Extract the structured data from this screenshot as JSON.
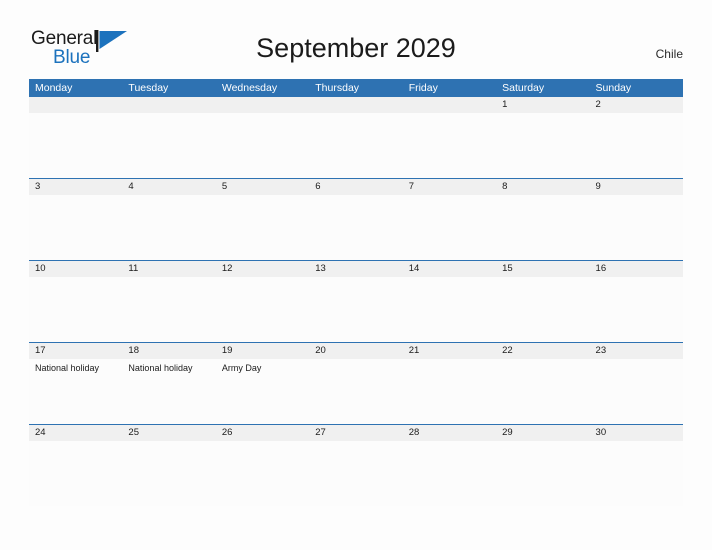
{
  "brand": {
    "name_part1": "General",
    "name_part2": "Blue",
    "flag_icon": "blue-triangle-flag-icon",
    "accent_color": "#1c72bd"
  },
  "header": {
    "title": "September 2029",
    "country": "Chile"
  },
  "theme": {
    "header_blue": "#2e72b2",
    "date_strip_gray": "#f0f0f0",
    "cell_white": "#fcfcfc",
    "page_background": "#fdfdfd",
    "text_dark": "#1b1b1b"
  },
  "calendar": {
    "weekdays": [
      "Monday",
      "Tuesday",
      "Wednesday",
      "Thursday",
      "Friday",
      "Saturday",
      "Sunday"
    ],
    "weeks": [
      {
        "days": [
          {
            "num": "",
            "events": []
          },
          {
            "num": "",
            "events": []
          },
          {
            "num": "",
            "events": []
          },
          {
            "num": "",
            "events": []
          },
          {
            "num": "",
            "events": []
          },
          {
            "num": "1",
            "events": []
          },
          {
            "num": "2",
            "events": []
          }
        ]
      },
      {
        "days": [
          {
            "num": "3",
            "events": []
          },
          {
            "num": "4",
            "events": []
          },
          {
            "num": "5",
            "events": []
          },
          {
            "num": "6",
            "events": []
          },
          {
            "num": "7",
            "events": []
          },
          {
            "num": "8",
            "events": []
          },
          {
            "num": "9",
            "events": []
          }
        ]
      },
      {
        "days": [
          {
            "num": "10",
            "events": []
          },
          {
            "num": "11",
            "events": []
          },
          {
            "num": "12",
            "events": []
          },
          {
            "num": "13",
            "events": []
          },
          {
            "num": "14",
            "events": []
          },
          {
            "num": "15",
            "events": []
          },
          {
            "num": "16",
            "events": []
          }
        ]
      },
      {
        "days": [
          {
            "num": "17",
            "events": [
              "National holiday"
            ]
          },
          {
            "num": "18",
            "events": [
              "National holiday"
            ]
          },
          {
            "num": "19",
            "events": [
              "Army Day"
            ]
          },
          {
            "num": "20",
            "events": []
          },
          {
            "num": "21",
            "events": []
          },
          {
            "num": "22",
            "events": []
          },
          {
            "num": "23",
            "events": []
          }
        ]
      },
      {
        "days": [
          {
            "num": "24",
            "events": []
          },
          {
            "num": "25",
            "events": []
          },
          {
            "num": "26",
            "events": []
          },
          {
            "num": "27",
            "events": []
          },
          {
            "num": "28",
            "events": []
          },
          {
            "num": "29",
            "events": []
          },
          {
            "num": "30",
            "events": []
          }
        ]
      }
    ]
  }
}
